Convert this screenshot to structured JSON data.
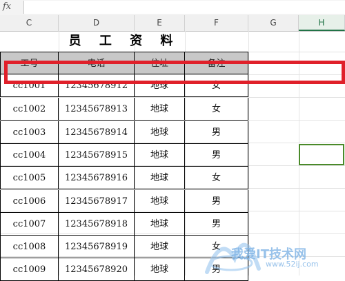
{
  "formula_bar": {
    "fx_label": "fx",
    "value": ""
  },
  "columns": [
    "C",
    "D",
    "E",
    "F",
    "G",
    "H"
  ],
  "active_column": "H",
  "sheet": {
    "title": "员 工 资 料",
    "headers": [
      "工号",
      "电话",
      "住址",
      "备注"
    ],
    "rows": [
      [
        "cc1001",
        "12345678912",
        "地球",
        "女"
      ],
      [
        "cc1002",
        "12345678913",
        "地球",
        "女"
      ],
      [
        "cc1003",
        "12345678914",
        "地球",
        "男"
      ],
      [
        "cc1004",
        "12345678915",
        "地球",
        "男"
      ],
      [
        "cc1005",
        "12345678916",
        "地球",
        "女"
      ],
      [
        "cc1006",
        "12345678917",
        "地球",
        "男"
      ],
      [
        "cc1007",
        "12345678918",
        "地球",
        "男"
      ],
      [
        "cc1008",
        "12345678919",
        "地球",
        "女"
      ],
      [
        "cc1009",
        "12345678920",
        "地球",
        "男"
      ]
    ]
  },
  "watermark": {
    "text": "我爱IT技术网",
    "sub": "www.52ij.com"
  },
  "colors": {
    "highlight": "#e0202a",
    "selection": "#4a8a2a",
    "header_fill": "#c8c8c8"
  }
}
